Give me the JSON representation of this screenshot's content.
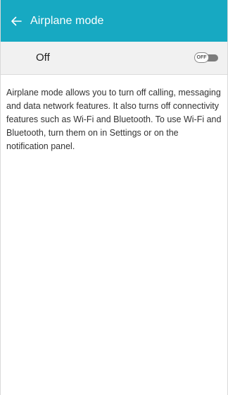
{
  "header": {
    "title": "Airplane mode",
    "back_icon": "arrow-left-icon",
    "background_color": "#17a9c2"
  },
  "master_switch": {
    "label": "Off",
    "toggle_text": "OFF",
    "state": "off"
  },
  "description": "Airplane mode allows you to turn off calling, messaging and data network features. It also turns off connectivity features such as Wi-Fi and Bluetooth. To use Wi-Fi and Bluetooth, turn them on in Settings or on the notification panel."
}
